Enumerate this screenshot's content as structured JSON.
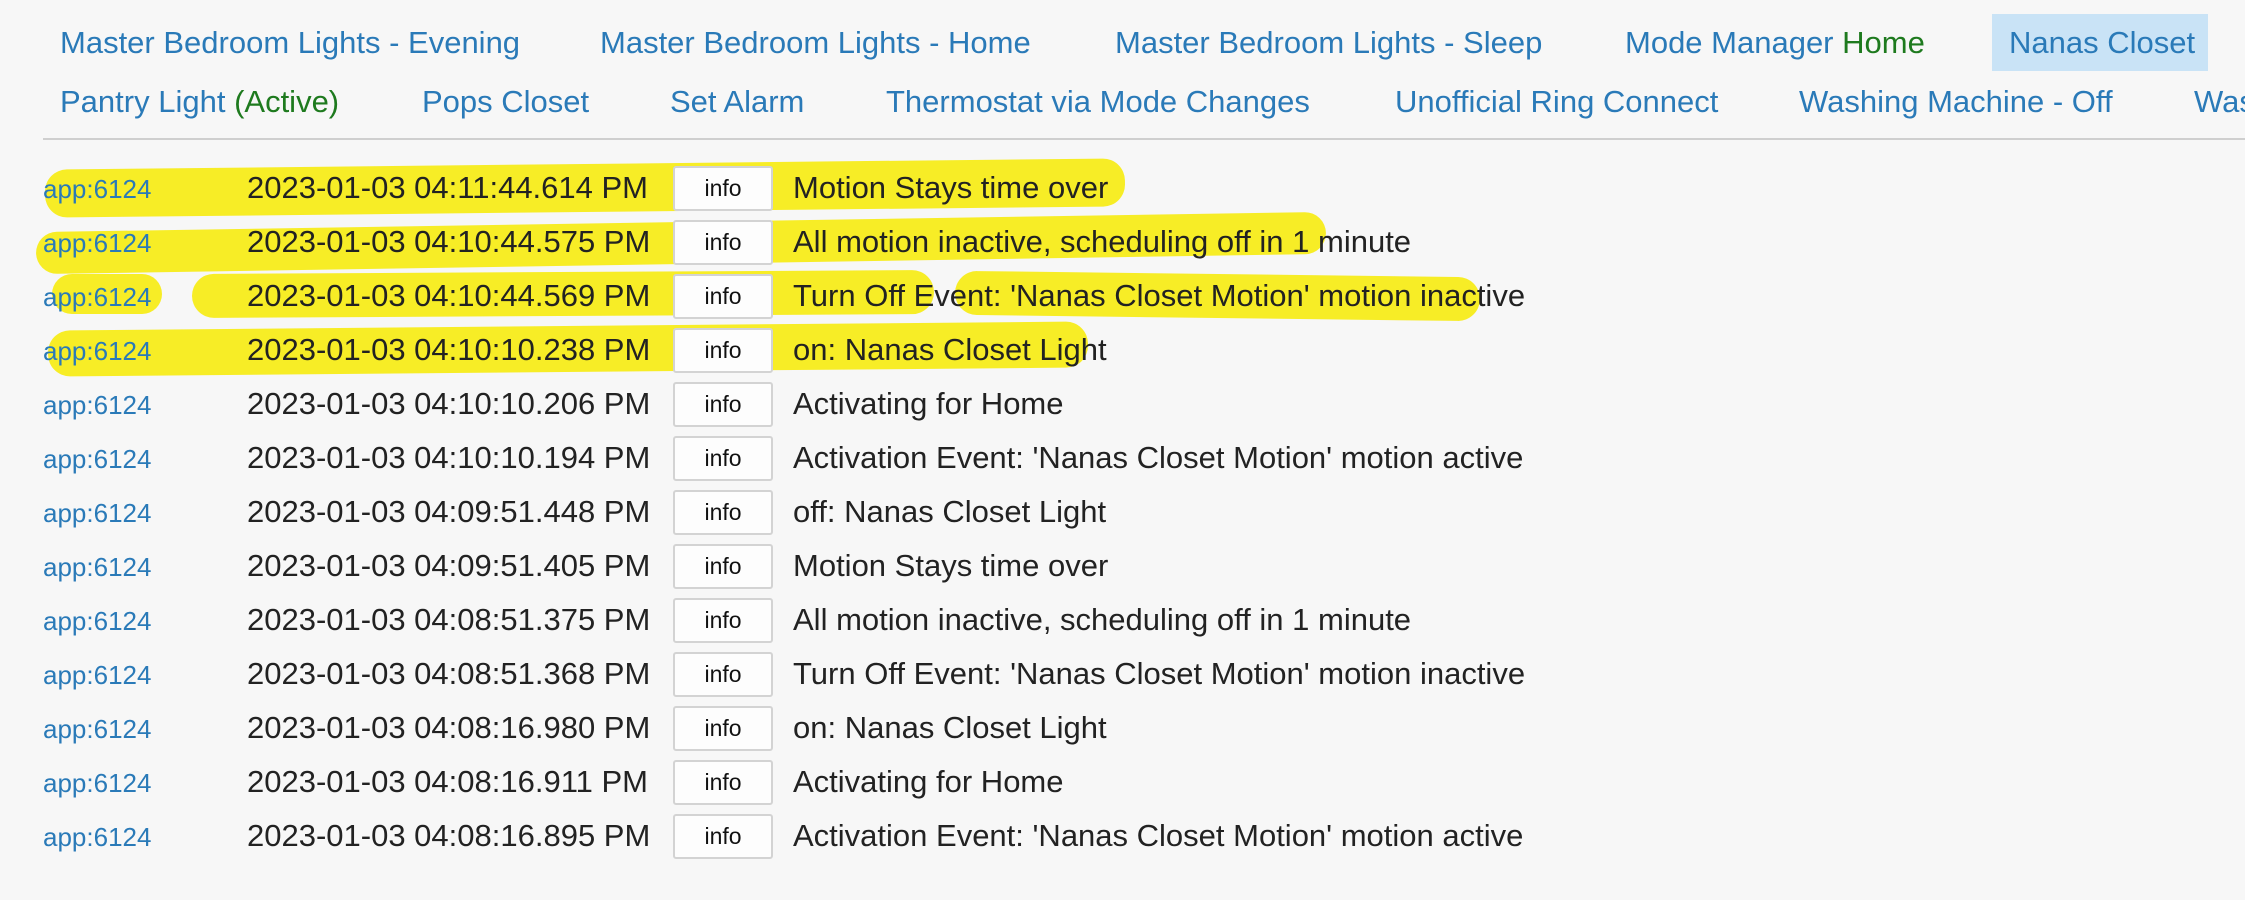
{
  "tabs_row1": [
    {
      "label": "Master Bedroom Lights - Evening",
      "suffix": ""
    },
    {
      "label": "Master Bedroom Lights - Home",
      "suffix": ""
    },
    {
      "label": "Master Bedroom Lights - Sleep",
      "suffix": ""
    },
    {
      "label": "Mode Manager",
      "suffix": "Home"
    },
    {
      "label": "Nanas Closet",
      "suffix": "",
      "selected": true
    }
  ],
  "tabs_row2": [
    {
      "label": "Pantry Light",
      "suffix": "(Active)"
    },
    {
      "label": "Pops Closet",
      "suffix": ""
    },
    {
      "label": "Set Alarm",
      "suffix": ""
    },
    {
      "label": "Thermostat via Mode Changes",
      "suffix": ""
    },
    {
      "label": "Unofficial Ring Connect",
      "suffix": ""
    },
    {
      "label": "Washing Machine - Off",
      "suffix": ""
    },
    {
      "label": "Was",
      "suffix": ""
    }
  ],
  "colors": {
    "link": "#2a7ab8",
    "active_green": "#1e7a1e",
    "selected_tab_bg": "#c9e3f6",
    "highlight": "#f6eb13"
  },
  "log": [
    {
      "app": "app:6124",
      "time": "2023-01-03 04:11:44.614 PM",
      "level": "info",
      "message": "Motion Stays time over"
    },
    {
      "app": "app:6124",
      "time": "2023-01-03 04:10:44.575 PM",
      "level": "info",
      "message": "All motion inactive, scheduling off in 1 minute"
    },
    {
      "app": "app:6124",
      "time": "2023-01-03 04:10:44.569 PM",
      "level": "info",
      "message": "Turn Off Event: 'Nanas Closet Motion' motion inactive"
    },
    {
      "app": "app:6124",
      "time": "2023-01-03 04:10:10.238 PM",
      "level": "info",
      "message": "on: Nanas Closet Light"
    },
    {
      "app": "app:6124",
      "time": "2023-01-03 04:10:10.206 PM",
      "level": "info",
      "message": "Activating for Home"
    },
    {
      "app": "app:6124",
      "time": "2023-01-03 04:10:10.194 PM",
      "level": "info",
      "message": "Activation Event: 'Nanas Closet Motion' motion active"
    },
    {
      "app": "app:6124",
      "time": "2023-01-03 04:09:51.448 PM",
      "level": "info",
      "message": "off: Nanas Closet Light"
    },
    {
      "app": "app:6124",
      "time": "2023-01-03 04:09:51.405 PM",
      "level": "info",
      "message": "Motion Stays time over"
    },
    {
      "app": "app:6124",
      "time": "2023-01-03 04:08:51.375 PM",
      "level": "info",
      "message": "All motion inactive, scheduling off in 1 minute"
    },
    {
      "app": "app:6124",
      "time": "2023-01-03 04:08:51.368 PM",
      "level": "info",
      "message": "Turn Off Event: 'Nanas Closet Motion' motion inactive"
    },
    {
      "app": "app:6124",
      "time": "2023-01-03 04:08:16.980 PM",
      "level": "info",
      "message": "on: Nanas Closet Light"
    },
    {
      "app": "app:6124",
      "time": "2023-01-03 04:08:16.911 PM",
      "level": "info",
      "message": "Activating for Home"
    },
    {
      "app": "app:6124",
      "time": "2023-01-03 04:08:16.895 PM",
      "level": "info",
      "message": "Activation Event: 'Nanas Closet Motion' motion active"
    }
  ]
}
